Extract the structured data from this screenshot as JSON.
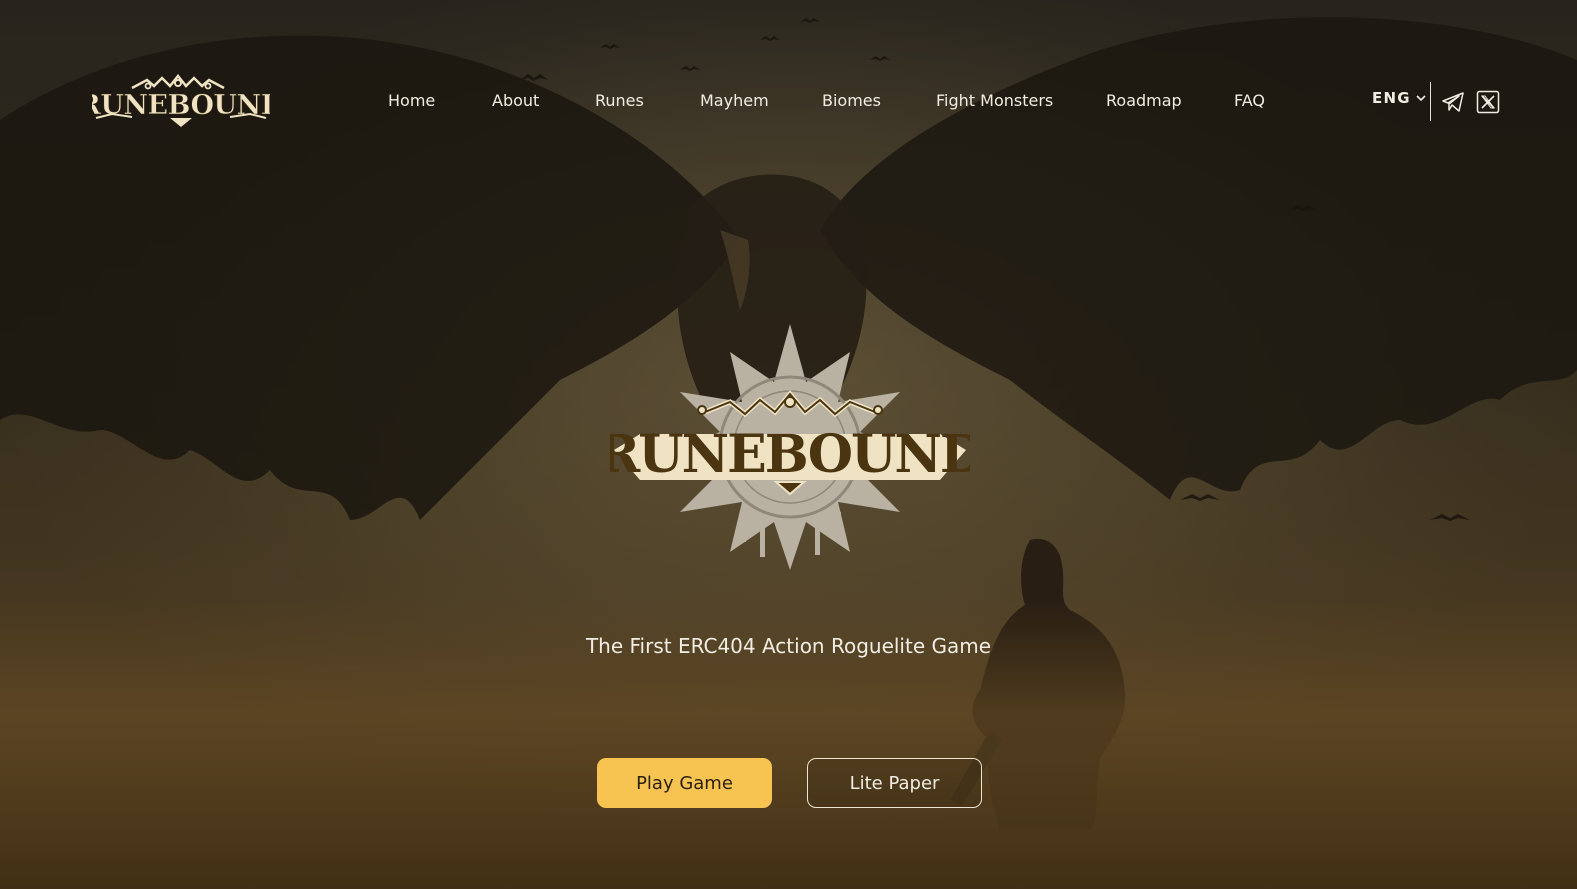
{
  "brand": {
    "name": "RUNEBOUND"
  },
  "nav": {
    "items": [
      {
        "label": "Home"
      },
      {
        "label": "About"
      },
      {
        "label": "Runes"
      },
      {
        "label": "Mayhem"
      },
      {
        "label": "Biomes"
      },
      {
        "label": "Fight Monsters"
      },
      {
        "label": "Roadmap"
      },
      {
        "label": "FAQ"
      }
    ]
  },
  "language": {
    "selected": "ENG",
    "icon": "chevron-down-icon"
  },
  "social": {
    "telegram_icon": "telegram-icon",
    "x_icon": "x-icon"
  },
  "hero": {
    "emblem_text": "RUNEBOUND",
    "tagline": "The First ERC404 Action Roguelite Game",
    "primary_button": "Play Game",
    "secondary_button": "Lite Paper"
  },
  "colors": {
    "accent": "#f8c451",
    "text": "#f2ede2",
    "logo_cream": "#efe3c4",
    "logo_brown": "#4a3510"
  }
}
